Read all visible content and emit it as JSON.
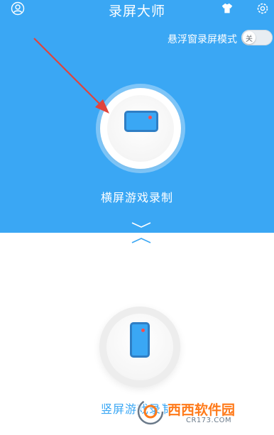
{
  "header": {
    "title": "录屏大师",
    "user_icon": "user-circle-icon",
    "skin_icon": "clothes-icon",
    "settings_icon": "gear-icon"
  },
  "floating_window": {
    "label": "悬浮窗录屏模式",
    "toggle_text": "关",
    "toggle_state": "off"
  },
  "modes": {
    "landscape_label": "横屏游戏录制",
    "landscape_icon": "landscape-phone-icon",
    "portrait_label": "竖屏游戏录制",
    "portrait_icon": "portrait-phone-icon"
  },
  "watermark": {
    "brand": "西西软件园",
    "url": "CR173.COM"
  },
  "colors": {
    "primary_blue": "#3aa7f4",
    "annotation_arrow": "#e0443c",
    "record_dot": "#ff4b4b",
    "watermark_orange": "#ff7a1a"
  }
}
